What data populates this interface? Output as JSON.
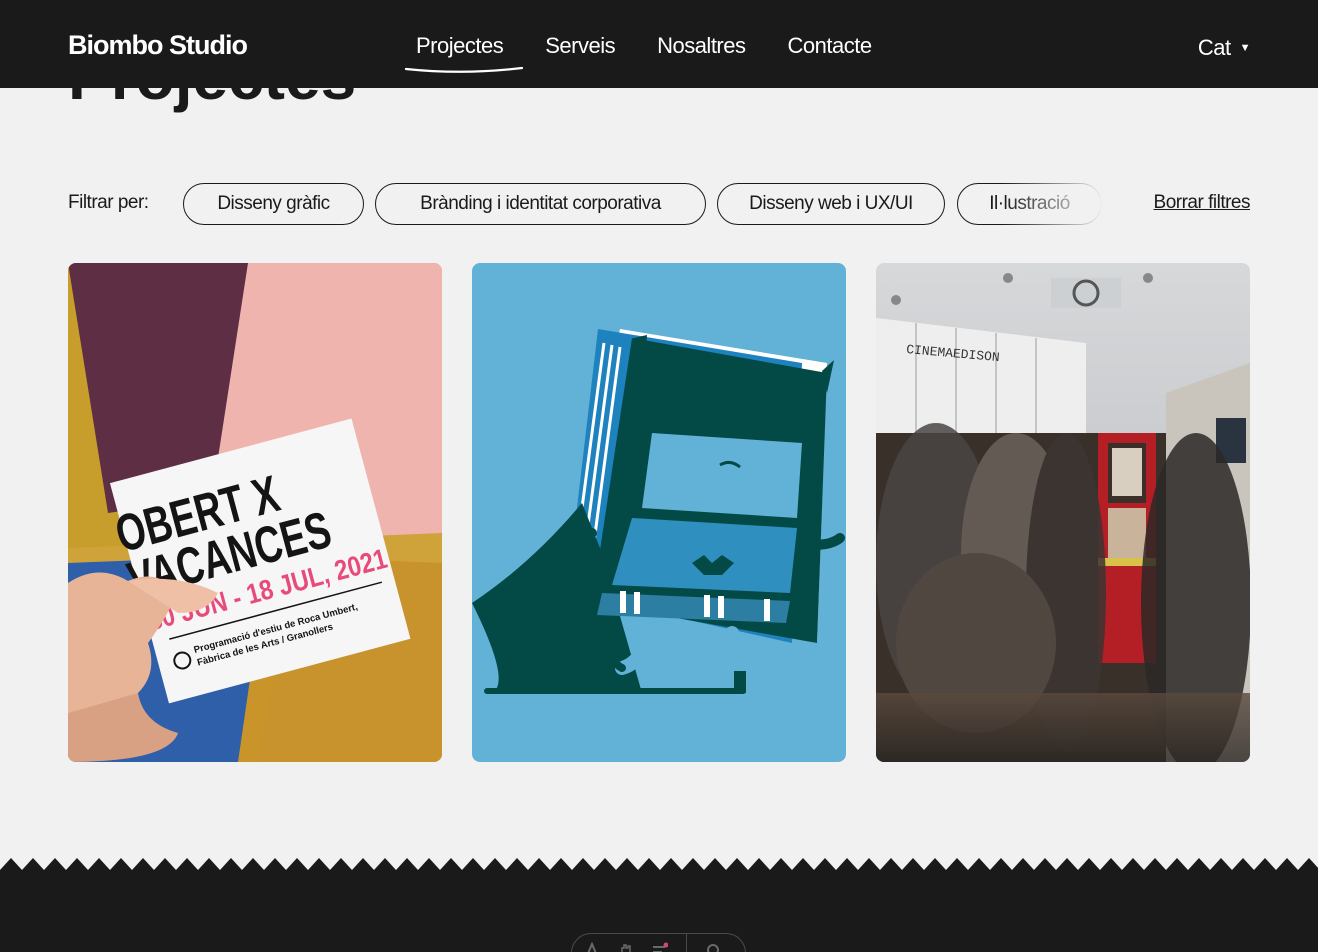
{
  "header": {
    "logo": "Biombo Studio",
    "nav": [
      {
        "label": "Projectes",
        "active": true
      },
      {
        "label": "Serveis",
        "active": false
      },
      {
        "label": "Nosaltres",
        "active": false
      },
      {
        "label": "Contacte",
        "active": false
      }
    ],
    "language": "Cat"
  },
  "page_title": "Projectes",
  "filters": {
    "label": "Filtrar per:",
    "chips": [
      "Disseny gràfic",
      "Brànding i identitat corporativa",
      "Disseny web i UX/UI",
      "Il·lustració"
    ],
    "clear_label": "Borrar filtres"
  },
  "projects": {
    "card1": {
      "poster_title_line1": "OBERT X",
      "poster_title_line2": "VACANCES",
      "poster_dates": "30 JUN - 18 JUL, 2021",
      "poster_line1": "Programació d'estiu de Roca Umbert,",
      "poster_line2": "Fàbrica de les Arts  /  Granollers"
    },
    "card3": {
      "sign": "CINEMAEDISON"
    }
  },
  "colors": {
    "header_bg": "#1a1a1b",
    "page_bg": "#f1f1f1",
    "card2_bg": "#62b2d8",
    "card2_ink": "#034a47"
  }
}
